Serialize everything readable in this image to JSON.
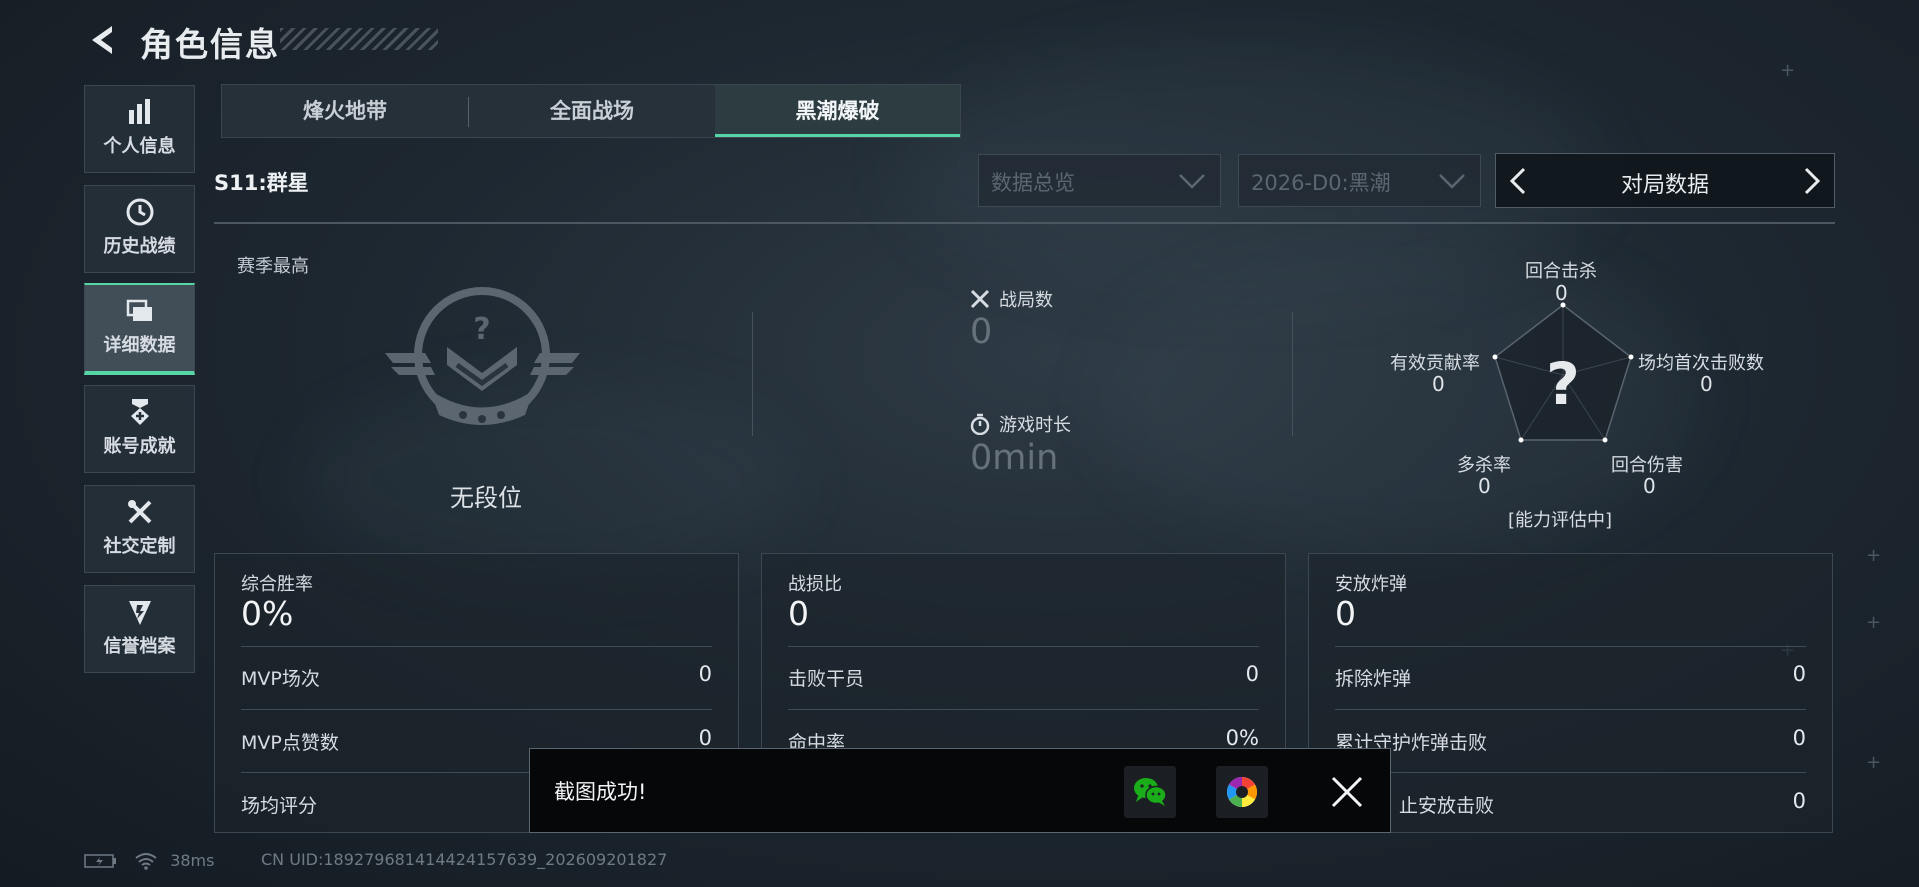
{
  "header": {
    "title": "角色信息"
  },
  "sidebar": {
    "items": [
      {
        "label": "个人信息",
        "icon": "bar-chart-icon"
      },
      {
        "label": "历史战绩",
        "icon": "history-icon"
      },
      {
        "label": "详细数据",
        "icon": "folder-icon",
        "active": true
      },
      {
        "label": "账号成就",
        "icon": "medal-icon"
      },
      {
        "label": "社交定制",
        "icon": "tools-icon"
      },
      {
        "label": "信誉档案",
        "icon": "shield-icon"
      }
    ]
  },
  "tabs": [
    {
      "label": "烽火地带"
    },
    {
      "label": "全面战场"
    },
    {
      "label": "黑潮爆破",
      "active": true
    }
  ],
  "filters": {
    "season_label": "S11:群星",
    "overview_select": "数据总览",
    "season_select": "2026-D0:黑潮",
    "switcher_label": "对局数据"
  },
  "overview": {
    "best_label": "赛季最高",
    "rank": "无段位",
    "matches_label": "战局数",
    "matches_value": "0",
    "time_label": "游戏时长",
    "time_value": "0min"
  },
  "radar": {
    "center": "?",
    "status": "[能力评估中]",
    "axes": [
      {
        "label": "回合击杀",
        "value": "0"
      },
      {
        "label": "场均首次击败数",
        "value": "0"
      },
      {
        "label": "回合伤害",
        "value": "0"
      },
      {
        "label": "多杀率",
        "value": "0"
      },
      {
        "label": "有效贡献率",
        "value": "0"
      }
    ]
  },
  "cards": [
    {
      "title": "综合胜率",
      "value": "0%",
      "rows": [
        {
          "label": "MVP场次",
          "value": "0"
        },
        {
          "label": "MVP点赞数",
          "value": "0"
        },
        {
          "label": "场均评分",
          "value": ""
        }
      ]
    },
    {
      "title": "战损比",
      "value": "0",
      "rows": [
        {
          "label": "击败干员",
          "value": "0"
        },
        {
          "label": "命中率",
          "value": "0%"
        },
        {
          "label": "",
          "value": ""
        }
      ]
    },
    {
      "title": "安放炸弹",
      "value": "0",
      "rows": [
        {
          "label": "拆除炸弹",
          "value": "0"
        },
        {
          "label": "累计守护炸弹击败",
          "value": "0"
        },
        {
          "label": "止安放击败",
          "value": "0"
        }
      ]
    }
  ],
  "toast": {
    "text": "截图成功!",
    "share_icons": [
      "wechat-icon",
      "album-icon"
    ]
  },
  "statusbar": {
    "ping": "38ms",
    "uid": "CN UID:18927968141442415763​9_202609201827"
  },
  "colors": {
    "accent": "#56d6a6",
    "background": "#1e2831"
  }
}
